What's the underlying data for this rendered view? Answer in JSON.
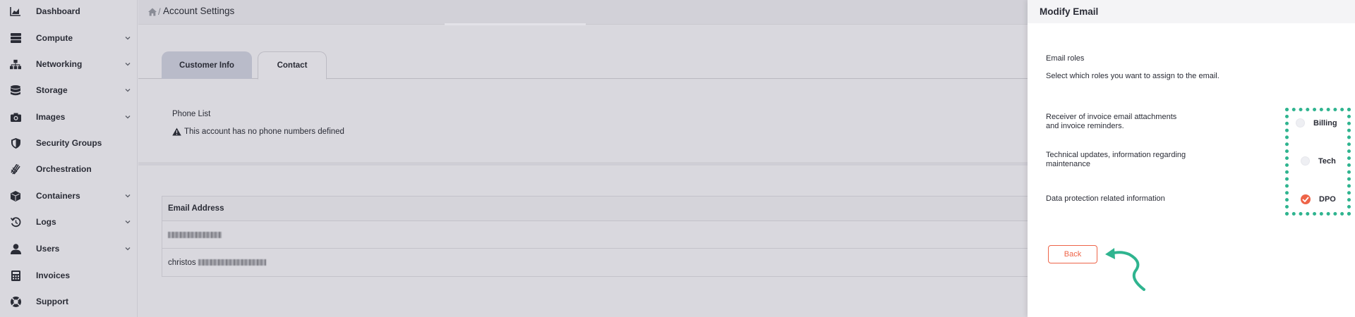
{
  "sidebar": {
    "items": [
      {
        "label": "Dashboard",
        "icon": "chart-area-icon",
        "expandable": false
      },
      {
        "label": "Compute",
        "icon": "server-icon",
        "expandable": true
      },
      {
        "label": "Networking",
        "icon": "network-icon",
        "expandable": true
      },
      {
        "label": "Storage",
        "icon": "database-icon",
        "expandable": true
      },
      {
        "label": "Images",
        "icon": "camera-icon",
        "expandable": true
      },
      {
        "label": "Security Groups",
        "icon": "shield-icon",
        "expandable": false
      },
      {
        "label": "Orchestration",
        "icon": "orchestration-icon",
        "expandable": false
      },
      {
        "label": "Containers",
        "icon": "cube-icon",
        "expandable": true
      },
      {
        "label": "Logs",
        "icon": "history-icon",
        "expandable": true
      },
      {
        "label": "Users",
        "icon": "user-icon",
        "expandable": true
      },
      {
        "label": "Invoices",
        "icon": "calculator-icon",
        "expandable": false
      },
      {
        "label": "Support",
        "icon": "lifebuoy-icon",
        "expandable": false
      }
    ]
  },
  "header": {
    "breadcrumb_separator": "/",
    "title": "Account Settings"
  },
  "tabs": [
    {
      "label": "Customer Info",
      "active": false
    },
    {
      "label": "Contact",
      "active": true
    }
  ],
  "phone_list": {
    "title": "Phone List",
    "empty_message": "This account has no phone numbers defined"
  },
  "email_table": {
    "header": "Email Address",
    "rows": [
      {
        "prefix": ""
      },
      {
        "prefix": "christos"
      }
    ]
  },
  "panel": {
    "title": "Modify Email",
    "section_title": "Email roles",
    "section_subtitle": "Select which roles you want to assign to the email.",
    "roles": [
      {
        "description_line1": "Receiver of invoice email attachments",
        "description_line2": "and invoice reminders.",
        "label": "Billing",
        "checked": false
      },
      {
        "description_line1": "Technical updates, information regarding",
        "description_line2": "maintenance",
        "label": "Tech",
        "checked": false
      },
      {
        "description_line1": "Data protection related information",
        "description_line2": "",
        "label": "DPO",
        "checked": true
      }
    ],
    "back_label": "Back"
  },
  "colors": {
    "accent": "#ee6448",
    "highlight": "#2fb48f",
    "sidebar_bg": "#d9d8de",
    "tab_inactive": "#b9bbc9"
  }
}
